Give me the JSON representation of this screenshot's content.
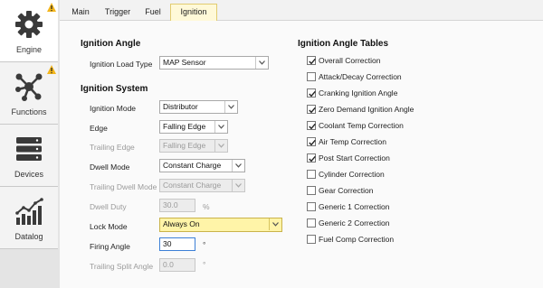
{
  "sidebar": {
    "items": [
      {
        "label": "Engine",
        "icon": "gear-icon",
        "active": true,
        "warning": true
      },
      {
        "label": "Functions",
        "icon": "network-icon",
        "active": false,
        "warning": true
      },
      {
        "label": "Devices",
        "icon": "server-icon",
        "active": false,
        "warning": false
      },
      {
        "label": "Datalog",
        "icon": "chart-icon",
        "active": false,
        "warning": false
      }
    ]
  },
  "tabs": [
    "Main",
    "Trigger",
    "Fuel",
    "Ignition"
  ],
  "active_tab": "Ignition",
  "ignition_angle": {
    "title": "Ignition Angle",
    "load_type_label": "Ignition Load Type",
    "load_type_value": "MAP Sensor"
  },
  "ignition_system": {
    "title": "Ignition System",
    "mode_label": "Ignition Mode",
    "mode_value": "Distributor",
    "edge_label": "Edge",
    "edge_value": "Falling Edge",
    "trailing_edge_label": "Trailing Edge",
    "trailing_edge_value": "Falling Edge",
    "dwell_mode_label": "Dwell Mode",
    "dwell_mode_value": "Constant Charge",
    "trailing_dwell_label": "Trailing Dwell Mode",
    "trailing_dwell_value": "Constant Charge",
    "dwell_duty_label": "Dwell Duty",
    "dwell_duty_value": "30.0",
    "dwell_duty_unit": "%",
    "lock_mode_label": "Lock Mode",
    "lock_mode_value": "Always On",
    "firing_angle_label": "Firing Angle",
    "firing_angle_value": "30",
    "firing_angle_unit": "°",
    "trailing_split_label": "Trailing Split Angle",
    "trailing_split_value": "0.0",
    "trailing_split_unit": "°"
  },
  "tables": {
    "title": "Ignition Angle Tables",
    "items": [
      {
        "label": "Overall Correction",
        "checked": true
      },
      {
        "label": "Attack/Decay Correction",
        "checked": false
      },
      {
        "label": "Cranking Ignition Angle",
        "checked": true
      },
      {
        "label": "Zero Demand Ignition Angle",
        "checked": true
      },
      {
        "label": "Coolant Temp Correction",
        "checked": true
      },
      {
        "label": "Air Temp Correction",
        "checked": true
      },
      {
        "label": "Post Start Correction",
        "checked": true
      },
      {
        "label": "Cylinder Correction",
        "checked": false
      },
      {
        "label": "Gear Correction",
        "checked": false
      },
      {
        "label": "Generic 1 Correction",
        "checked": false
      },
      {
        "label": "Generic 2 Correction",
        "checked": false
      },
      {
        "label": "Fuel Comp Correction",
        "checked": false
      }
    ]
  }
}
